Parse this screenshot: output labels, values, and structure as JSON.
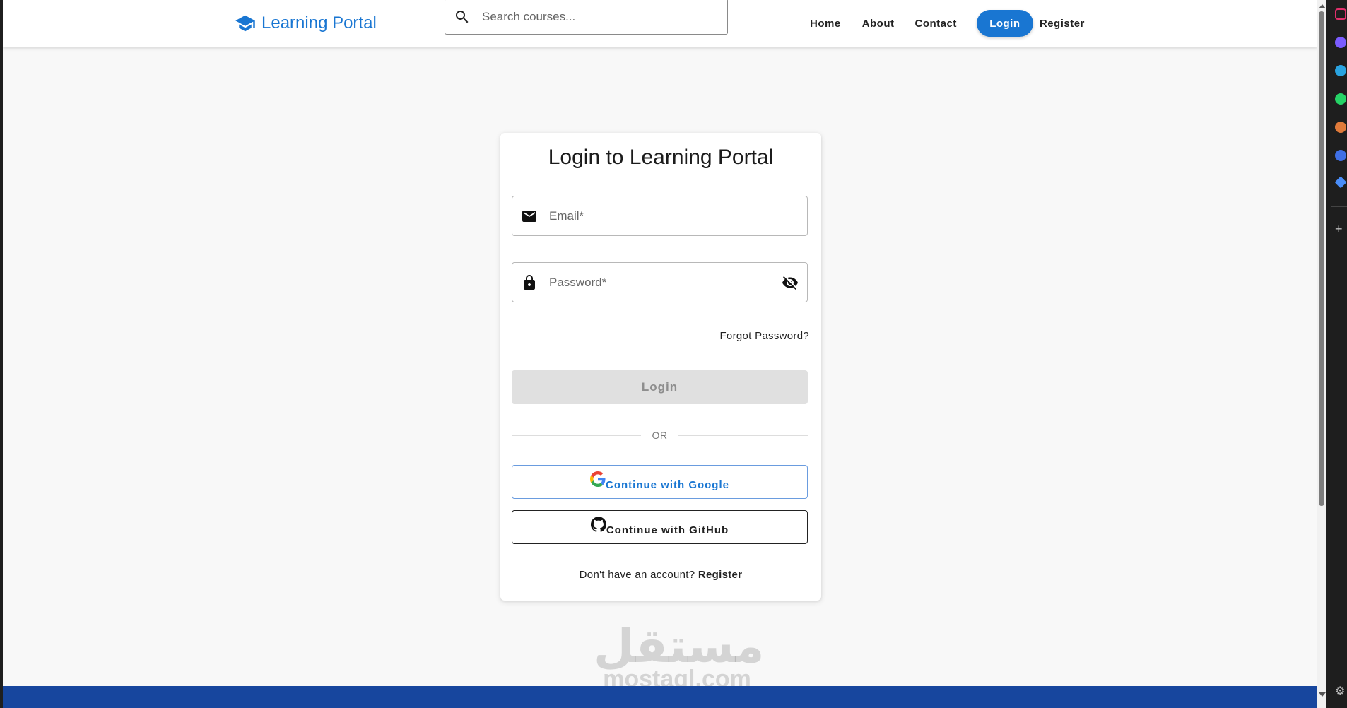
{
  "header": {
    "brand": "Learning Portal",
    "search_placeholder": "Search courses...",
    "nav": {
      "home": "Home",
      "about": "About",
      "contact": "Contact",
      "login": "Login",
      "register": "Register"
    }
  },
  "card": {
    "title": "Login to Learning Portal",
    "email_placeholder": "Email*",
    "password_placeholder": "Password*",
    "forgot": "Forgot Password?",
    "login_button": "Login",
    "or": "OR",
    "google_button": "Continue with Google",
    "github_button": "Continue with GitHub",
    "no_account": "Don't have an account?",
    "register_link": "Register"
  },
  "watermark": {
    "arabic": "مستقل",
    "latin": "mostaql.com"
  },
  "icons": {
    "brand": "school-icon",
    "search": "search-icon",
    "email": "email-icon",
    "password": "lock-icon",
    "visibility": "visibility-off-icon",
    "google": "google-icon",
    "github": "github-icon"
  },
  "colors": {
    "primary": "#1976d2",
    "footer": "#17469e",
    "disabled_button": "#e0e0e0"
  }
}
